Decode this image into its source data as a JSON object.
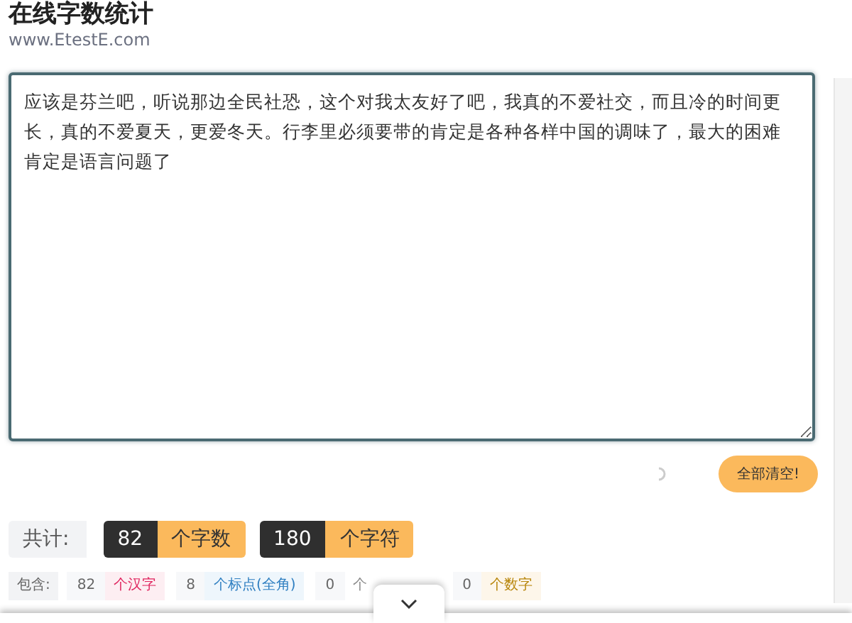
{
  "title": "在线字数统计",
  "subtitle": "www.EtestE.com",
  "text_input": {
    "value": "应该是芬兰吧，听说那边全民社恐，这个对我太友好了吧，我真的不爱社交，而且冷的时间更长，真的不爱夏天，更爱冬天。行李里必须要带的肯定是各种各样中国的调味了，最大的困难肯定是语言问题了"
  },
  "clear_button": "全部清空!",
  "totals": {
    "label": "共计:",
    "items": [
      {
        "count": "82",
        "unit": "个字数"
      },
      {
        "count": "180",
        "unit": "个字符"
      }
    ]
  },
  "breakdown": {
    "label": "包含:",
    "items": [
      {
        "count": "82",
        "unit": "个汉字",
        "color": "#e0245e"
      },
      {
        "count": "8",
        "unit": "个标点(全角)",
        "color": "#2f7fc1"
      },
      {
        "count": "0",
        "unit": "个",
        "color": "#888888"
      },
      {
        "count": "0",
        "unit": "个数字",
        "color": "#b8860b"
      }
    ]
  }
}
